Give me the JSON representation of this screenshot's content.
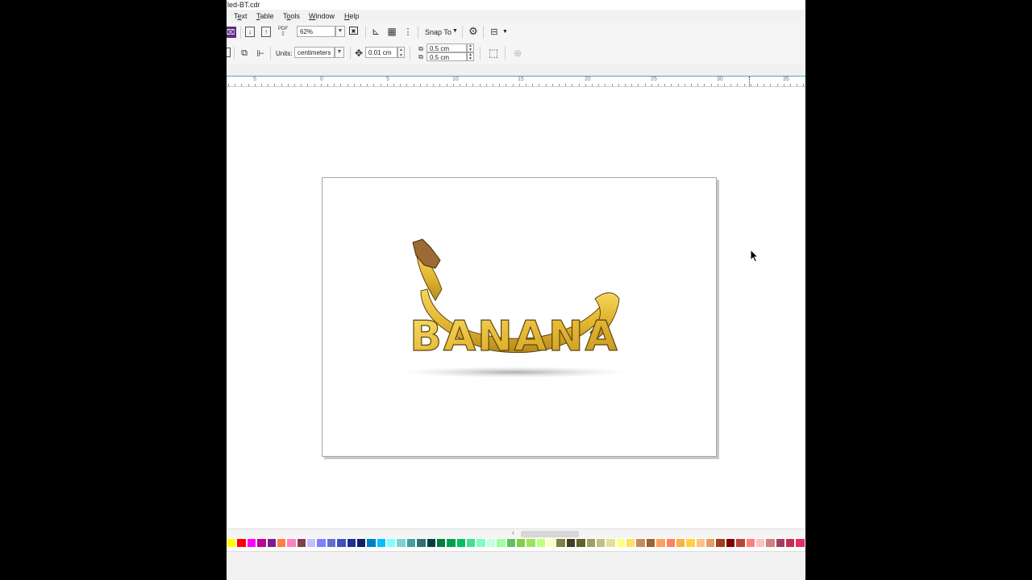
{
  "window": {
    "title": "led-BT.cdr"
  },
  "menu": {
    "items": [
      {
        "label": "Text",
        "underline_index": 1
      },
      {
        "label": "Table",
        "underline_index": 0
      },
      {
        "label": "Tools",
        "underline_index": 1
      },
      {
        "label": "Window",
        "underline_index": 0
      },
      {
        "label": "Help",
        "underline_index": 0
      }
    ]
  },
  "toolbar": {
    "zoom_value": "62%",
    "snap_label": "Snap To",
    "pdf_label": "PDF"
  },
  "property_bar": {
    "units_label": "Units:",
    "units_value": "centimeters",
    "nudge_value": "0.01 cm",
    "dup_x_value": "0.5 cm",
    "dup_y_value": "0.5 cm"
  },
  "ruler": {
    "labels": [
      "5",
      "0",
      "5",
      "10",
      "15",
      "20",
      "25",
      "30",
      "35"
    ]
  },
  "artwork": {
    "text": "BANANA"
  },
  "colors": {
    "banana_light": "#f3d25a",
    "banana_mid": "#e2b530",
    "banana_dark": "#b48a1c",
    "banana_outline": "#5a4610",
    "tip": "#8b5a2b",
    "selection_accent": "#4aa3d8"
  },
  "palette": [
    "#ffff00",
    "#ff0000",
    "#ff00ff",
    "#c0008f",
    "#7a1f8f",
    "#ff8040",
    "#ff80c0",
    "#80404a",
    "#c0c0ff",
    "#8080ff",
    "#6070d0",
    "#4050c0",
    "#203090",
    "#102060",
    "#0080c0",
    "#00c0ff",
    "#80ffff",
    "#80d0d0",
    "#40a0a0",
    "#307070",
    "#004040",
    "#008040",
    "#00a050",
    "#00c060",
    "#40e090",
    "#80ffc0",
    "#c0ffe0",
    "#a0ffa0",
    "#60c060",
    "#80d040",
    "#a0e060",
    "#c0ff80",
    "#ffffc0",
    "#808040",
    "#404020",
    "#606030",
    "#a0a060",
    "#c0c080",
    "#e0e0a0",
    "#ffff80",
    "#ffe060",
    "#c09060",
    "#a06030",
    "#ffa060",
    "#ff8060",
    "#ffb040",
    "#ffd040",
    "#ffc080",
    "#e0a060",
    "#a04020",
    "#800000",
    "#c04040",
    "#ff8080",
    "#ffc0c0",
    "#d08080",
    "#a04060",
    "#c03050",
    "#e03060"
  ]
}
